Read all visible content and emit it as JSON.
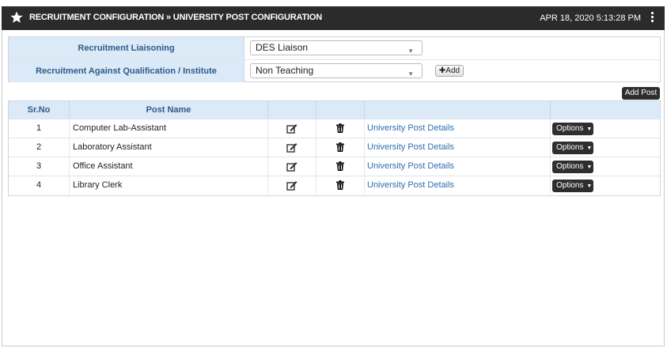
{
  "header": {
    "title": "RECRUITMENT CONFIGURATION » UNIVERSITY POST CONFIGURATION",
    "datetime": "APR 18, 2020  5:13:28 PM"
  },
  "form": {
    "liaison_label": "Recruitment Liaisoning",
    "liaison_value": "DES Liaison",
    "qualification_label": "Recruitment Against Qualification / Institute",
    "qualification_value": "Non Teaching",
    "add_label": "Add"
  },
  "add_post_label": "Add Post",
  "table": {
    "columns": [
      "Sr.No",
      "Post Name"
    ],
    "rows": [
      {
        "sr": "1",
        "name": "Computer Lab-Assistant",
        "link": "University Post Details",
        "options": "Options"
      },
      {
        "sr": "2",
        "name": "Laboratory Assistant",
        "link": "University Post Details",
        "options": "Options"
      },
      {
        "sr": "3",
        "name": "Office Assistant",
        "link": "University Post Details",
        "options": "Options"
      },
      {
        "sr": "4",
        "name": "Library Clerk",
        "link": "University Post Details",
        "options": "Options"
      }
    ]
  },
  "icons": {
    "header": "star-icon",
    "menu": "kebab-menu-icon",
    "edit": "edit-icon",
    "delete": "trash-icon"
  },
  "colors": {
    "header_bg": "#2b2b2b",
    "label_bg": "#dce9f7",
    "label_text": "#2b5c8a",
    "link": "#2f6fb0"
  }
}
